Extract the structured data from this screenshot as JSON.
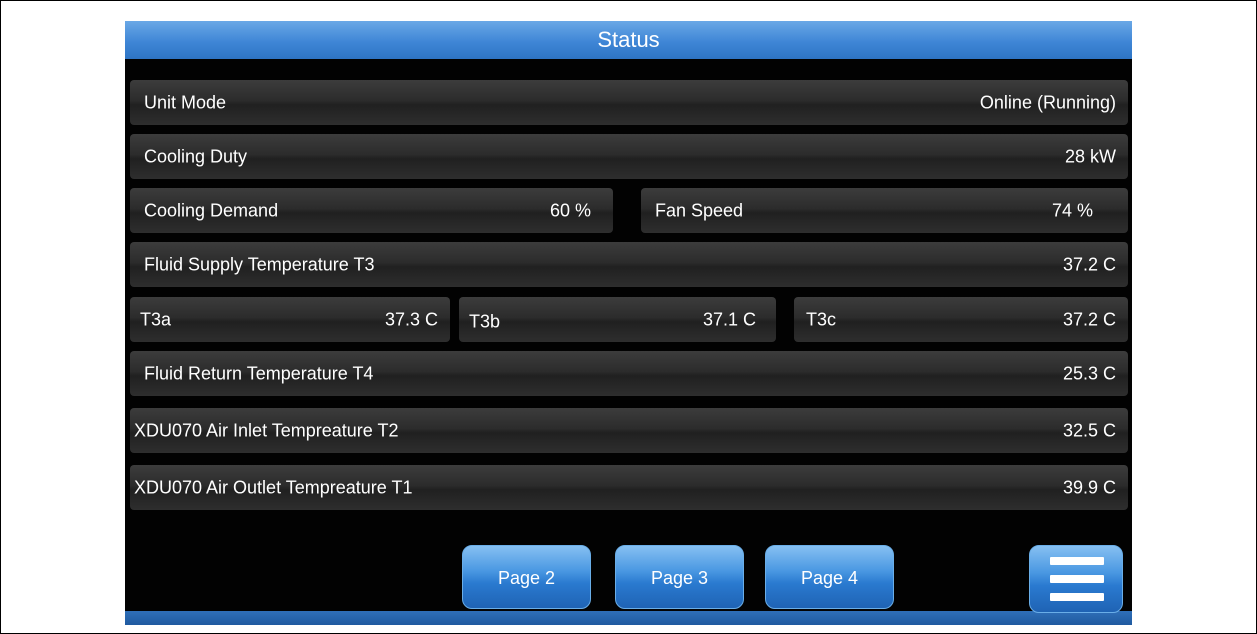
{
  "title": "Status",
  "rows": {
    "unit_mode": {
      "label": "Unit Mode",
      "value": "Online (Running)"
    },
    "cooling_duty": {
      "label": "Cooling Duty",
      "value": "28 kW"
    },
    "cooling_demand": {
      "label": "Cooling Demand",
      "value": "60 %"
    },
    "fan_speed": {
      "label": "Fan Speed",
      "value": "74 %"
    },
    "fluid_supply": {
      "label": "Fluid Supply Temperature T3",
      "value": "37.2 C"
    },
    "t3a": {
      "label": "T3a",
      "value": "37.3 C"
    },
    "t3b": {
      "label": "T3b",
      "value": "37.1 C"
    },
    "t3c": {
      "label": "T3c",
      "value": "37.2 C"
    },
    "fluid_return": {
      "label": "Fluid Return Temperature T4",
      "value": "25.3 C"
    },
    "air_inlet": {
      "label": "XDU070 Air Inlet Tempreature T2",
      "value": "32.5 C"
    },
    "air_outlet": {
      "label": "XDU070 Air Outlet Tempreature T1",
      "value": "39.9 C"
    }
  },
  "buttons": {
    "page2": "Page 2",
    "page3": "Page 3",
    "page4": "Page 4",
    "menu_icon": "hamburger-menu-icon"
  },
  "colors": {
    "title_bar": "#3f86d6",
    "background": "#020202",
    "button": "#2a7ad0"
  }
}
